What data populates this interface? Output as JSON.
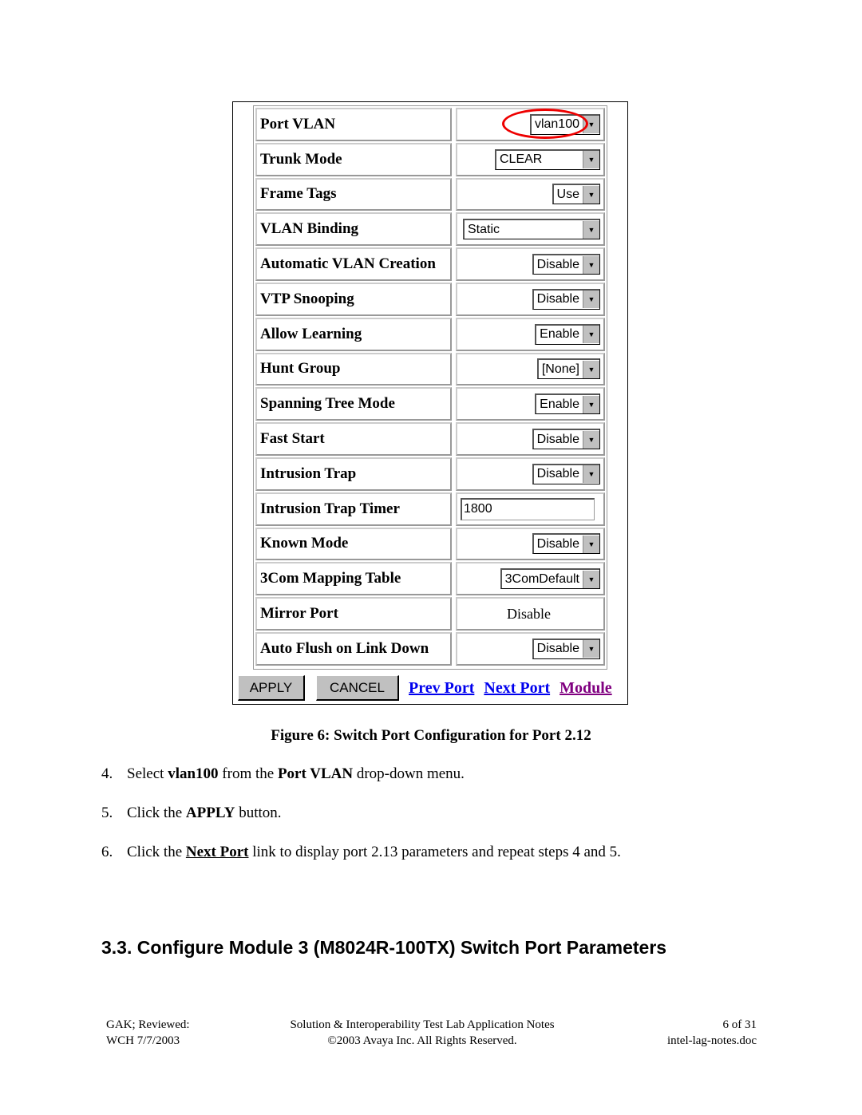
{
  "screenshot": {
    "rows": [
      {
        "label": "Port VLAN",
        "type": "select",
        "value": "vlan100",
        "highlighted": true
      },
      {
        "label": "Trunk Mode",
        "type": "select",
        "value": "CLEAR"
      },
      {
        "label": "Frame Tags",
        "type": "select",
        "value": "Use"
      },
      {
        "label": "VLAN Binding",
        "type": "select",
        "value": "Static"
      },
      {
        "label": "Automatic VLAN Creation",
        "type": "select",
        "value": "Disable"
      },
      {
        "label": "VTP Snooping",
        "type": "select",
        "value": "Disable"
      },
      {
        "label": "Allow Learning",
        "type": "select",
        "value": "Enable"
      },
      {
        "label": "Hunt Group",
        "type": "select",
        "value": "[None]"
      },
      {
        "label": "Spanning Tree Mode",
        "type": "select",
        "value": "Enable"
      },
      {
        "label": "Fast Start",
        "type": "select",
        "value": "Disable"
      },
      {
        "label": "Intrusion Trap",
        "type": "select",
        "value": "Disable"
      },
      {
        "label": "Intrusion Trap Timer",
        "type": "input",
        "value": "1800"
      },
      {
        "label": "Known Mode",
        "type": "select",
        "value": "Disable"
      },
      {
        "label": "3Com Mapping Table",
        "type": "select",
        "value": "3ComDefault"
      },
      {
        "label": "Mirror Port",
        "type": "text",
        "value": "Disable"
      },
      {
        "label": "Auto Flush on Link Down",
        "type": "select",
        "value": "Disable"
      }
    ],
    "buttons": {
      "apply": "APPLY",
      "cancel": "CANCEL"
    },
    "links": {
      "prev": "Prev Port",
      "next": "Next Port",
      "module": "Module"
    },
    "colors": {
      "link": "#0000ee",
      "visited": "#800080",
      "highlight": "#e00000"
    }
  },
  "caption": "Figure 6: Switch Port Configuration for Port 2.12",
  "steps": [
    {
      "num": "4.",
      "parts": [
        "Select ",
        "vlan100",
        " from the ",
        "Port VLAN",
        " drop-down menu."
      ]
    },
    {
      "num": "5.",
      "parts": [
        "Click the ",
        "APPLY",
        " button."
      ]
    },
    {
      "num": "6.",
      "parts": [
        "Click the ",
        "Next Port",
        " link to display port 2.13 parameters and repeat steps 4 and 5."
      ]
    }
  ],
  "heading": "3.3. Configure Module 3 (M8024R-100TX) Switch Port Parameters",
  "footer": {
    "left1": "GAK; Reviewed:",
    "left2": "WCH 7/7/2003",
    "center1": "Solution & Interoperability Test Lab Application Notes",
    "center2": "©2003 Avaya Inc. All Rights Reserved.",
    "right1": "6 of 31",
    "right2": "intel-lag-notes.doc"
  }
}
